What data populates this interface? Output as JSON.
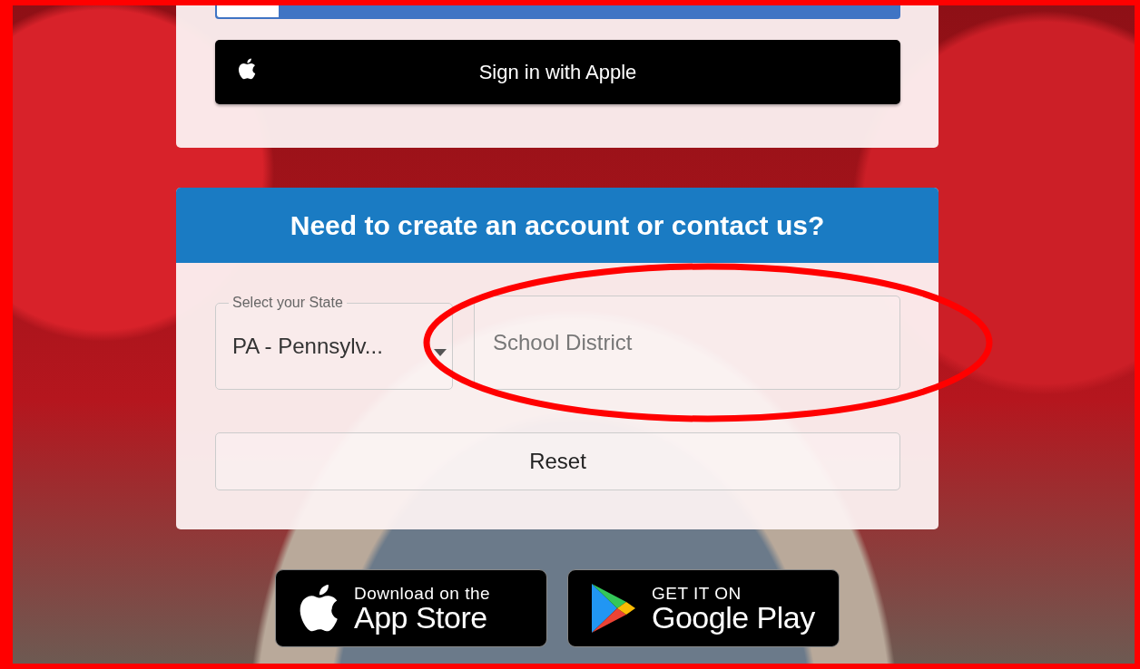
{
  "apple_button": {
    "label": "Sign in with Apple"
  },
  "contact_card": {
    "title": "Need to create an account or contact us?",
    "state_select": {
      "label": "Select your State",
      "value": "PA - Pennsylv..."
    },
    "district_field": {
      "placeholder": "School District"
    },
    "reset_button": {
      "label": "Reset"
    }
  },
  "store_badges": [
    {
      "kind": "app-store",
      "small_text": "Download on the",
      "large_text": "App Store"
    },
    {
      "kind": "google-play",
      "small_text": "GET IT ON",
      "large_text": "Google Play"
    }
  ]
}
